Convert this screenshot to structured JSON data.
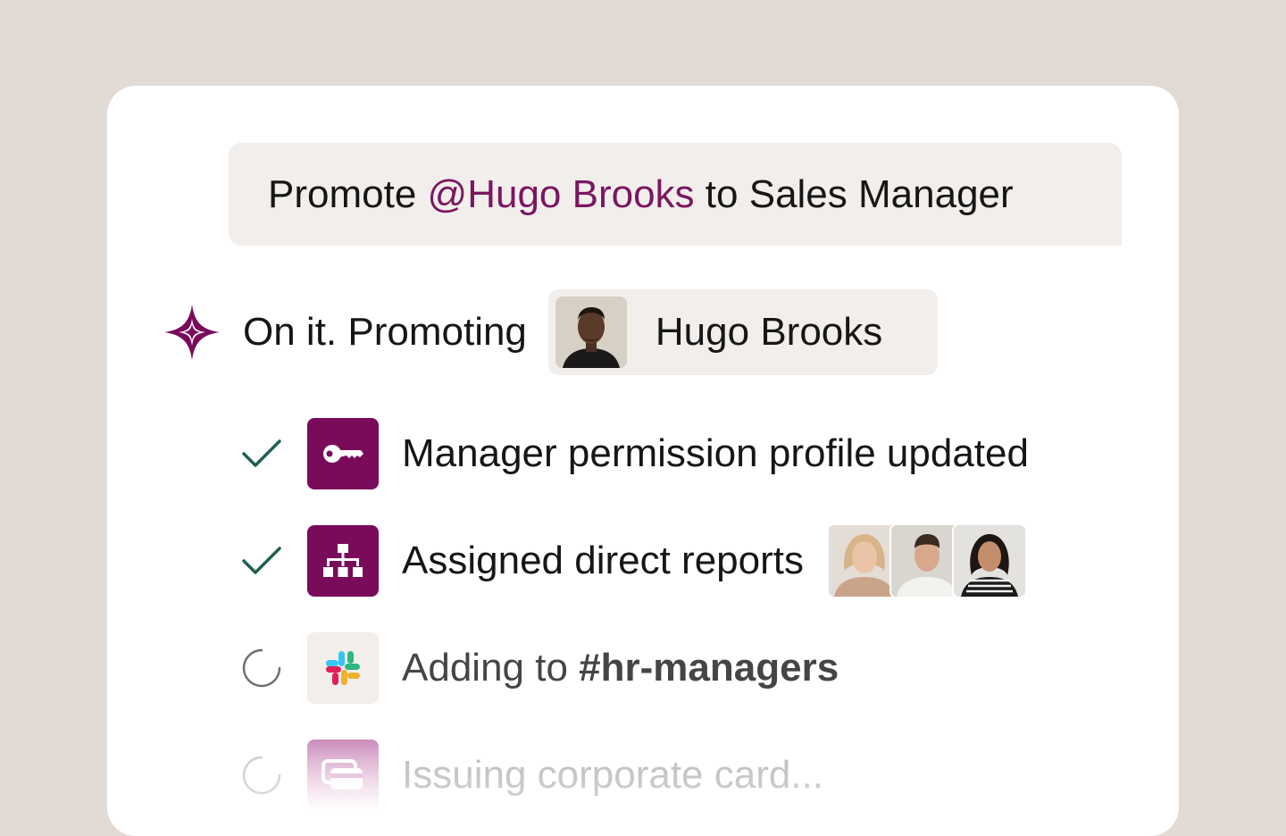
{
  "prompt": {
    "prefix": "Promote",
    "mention": "@Hugo Brooks",
    "suffix": "to Sales Manager"
  },
  "reply": {
    "icon": "sparkle-icon",
    "text": "On it. Promoting",
    "person": "Hugo Brooks"
  },
  "tasks": [
    {
      "status": "done",
      "icon": "key-icon",
      "label": "Manager permission profile updated"
    },
    {
      "status": "done",
      "icon": "org-chart-icon",
      "label": "Assigned direct reports"
    },
    {
      "status": "in-progress",
      "icon": "slack-icon",
      "label_prefix": "Adding to",
      "label_channel": "#hr-managers"
    },
    {
      "status": "pending",
      "icon": "card-icon",
      "label": "Issuing corporate card..."
    }
  ],
  "colors": {
    "background": "#e2dad4",
    "accent": "#7a0b5b",
    "mention": "#7a1760",
    "check": "#1f5f55",
    "chip": "#f1eeeb"
  }
}
